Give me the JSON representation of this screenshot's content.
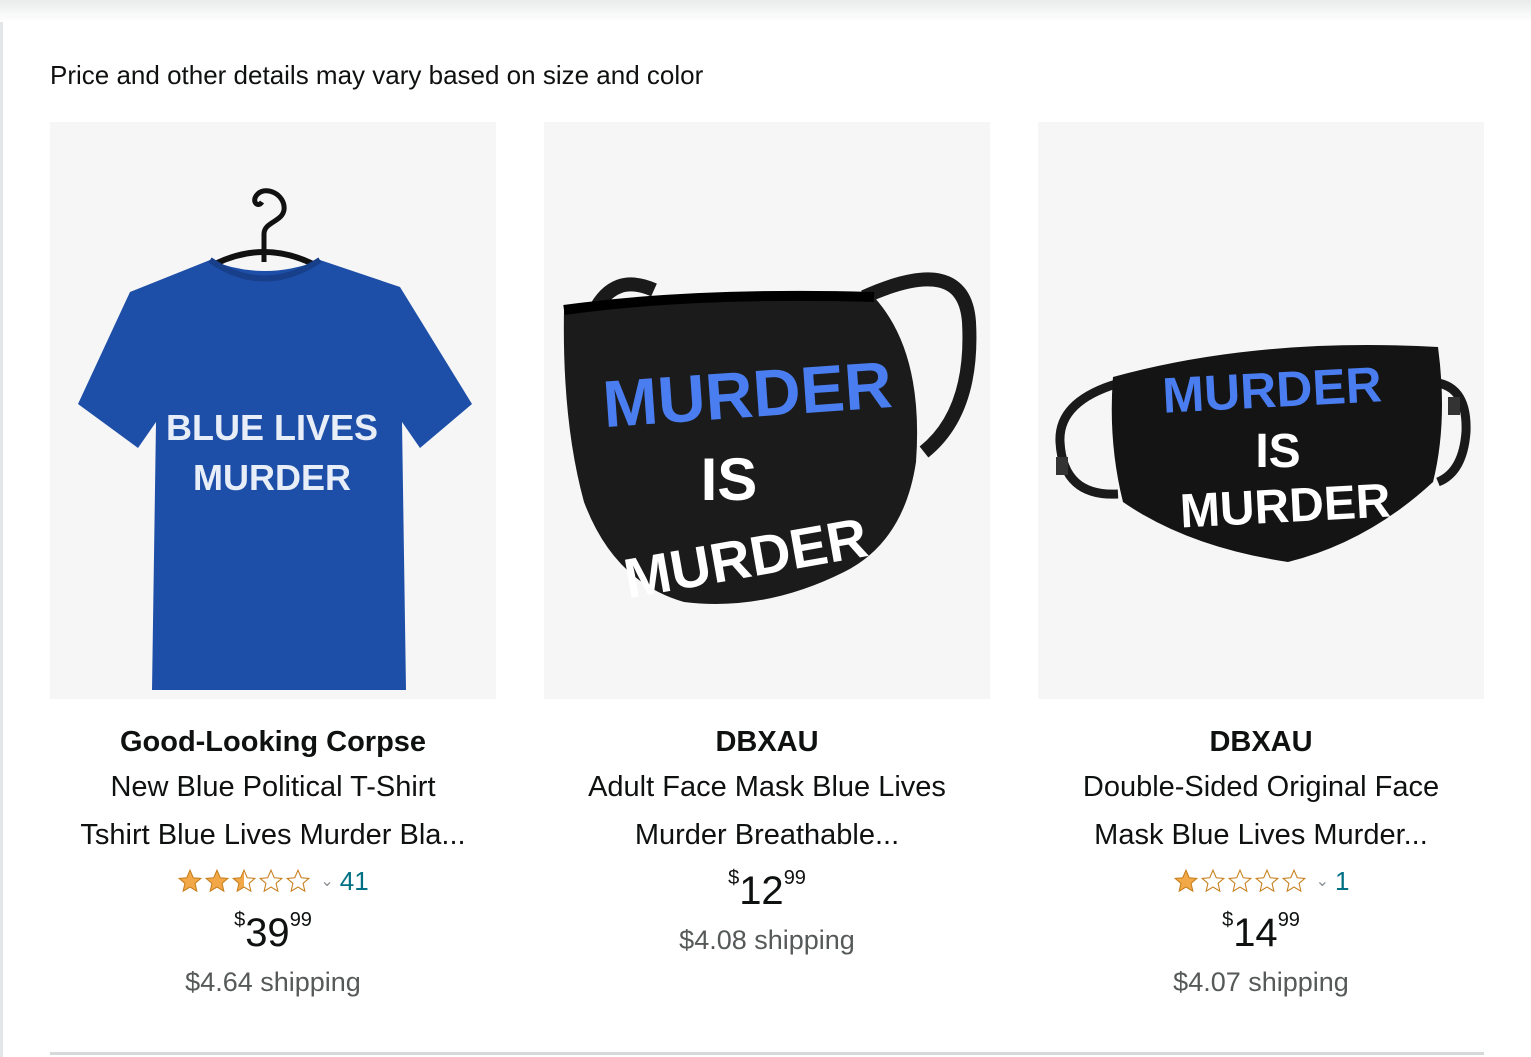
{
  "disclaimer": "Price and other details may vary based on size and color",
  "products": [
    {
      "brand": "Good-Looking Corpse",
      "title_line1": "New Blue Political T-Shirt",
      "title_line2": "Tshirt Blue Lives Murder Bla...",
      "rating_stars": 2.5,
      "rating_count": "41",
      "price_symbol": "$",
      "price_whole": "39",
      "price_fraction": "99",
      "shipping": "$4.64 shipping",
      "image_text_1": "BLUE LIVES",
      "image_text_2": "MURDER"
    },
    {
      "brand": "DBXAU",
      "title_line1": "Adult Face Mask Blue Lives",
      "title_line2": "Murder Breathable...",
      "price_symbol": "$",
      "price_whole": "12",
      "price_fraction": "99",
      "shipping": "$4.08 shipping",
      "image_text_1": "MURDER",
      "image_text_2": "IS",
      "image_text_3": "MURDER"
    },
    {
      "brand": "DBXAU",
      "title_line1": "Double-Sided Original Face",
      "title_line2": "Mask Blue Lives Murder...",
      "rating_stars": 1,
      "rating_count": "1",
      "price_symbol": "$",
      "price_whole": "14",
      "price_fraction": "99",
      "shipping": "$4.07 shipping",
      "image_text_1": "MURDER",
      "image_text_2": "IS",
      "image_text_3": "MURDER"
    }
  ],
  "colors": {
    "star": "#f3a847",
    "link": "#007185",
    "shipping": "#565959",
    "shirt": "#1e4fa8",
    "mask_blue": "#4a7ef0"
  }
}
